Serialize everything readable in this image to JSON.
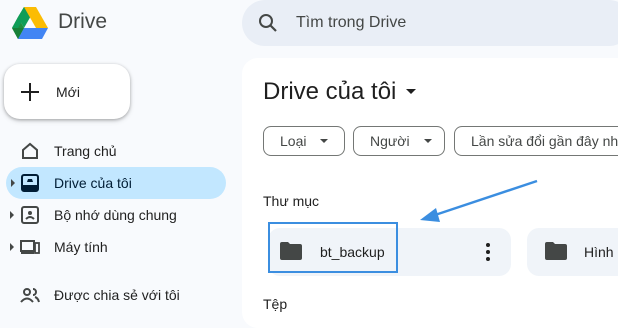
{
  "app": {
    "brand": "Drive",
    "logo_icon": "google-drive-logo"
  },
  "new_button": {
    "label": "Mới",
    "icon": "plus-icon"
  },
  "search": {
    "placeholder": "Tìm trong Drive",
    "icon": "search-icon"
  },
  "sidebar": {
    "items": [
      {
        "label": "Trang chủ",
        "icon": "home-icon",
        "expandable": false,
        "active": false
      },
      {
        "label": "Drive của tôi",
        "icon": "my-drive-icon",
        "expandable": true,
        "active": true
      },
      {
        "label": "Bộ nhớ dùng chung",
        "icon": "shared-drives-icon",
        "expandable": true,
        "active": false
      },
      {
        "label": "Máy tính",
        "icon": "computer-icon",
        "expandable": true,
        "active": false
      },
      {
        "label": "Được chia sẻ với tôi",
        "icon": "shared-with-me-icon",
        "expandable": false,
        "active": false
      }
    ]
  },
  "main": {
    "title": "Drive của tôi",
    "filters": [
      {
        "label": "Loại"
      },
      {
        "label": "Người"
      },
      {
        "label": "Lần sửa đổi gần đây nh"
      }
    ],
    "folders_heading": "Thư mục",
    "folders": [
      {
        "name": "bt_backup",
        "highlighted": true
      },
      {
        "name": "Hình"
      }
    ],
    "files_heading": "Tệp"
  },
  "colors": {
    "active_nav": "#c2e7ff",
    "highlight_border": "#3b8ee0",
    "search_bg": "#e9eef6"
  }
}
